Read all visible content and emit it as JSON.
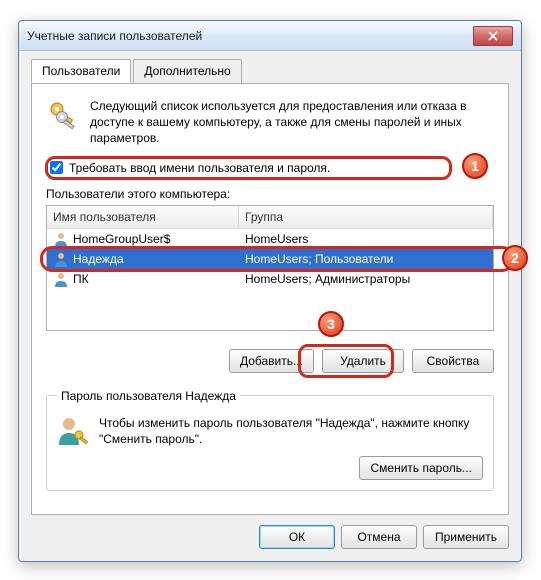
{
  "window": {
    "title": "Учетные записи пользователей"
  },
  "tabs": {
    "users": "Пользователи",
    "advanced": "Дополнительно"
  },
  "intro": "Следующий список используется для предоставления или отказа в доступе к вашему компьютеру, а также для смены паролей и иных параметров.",
  "checkbox": {
    "label": "Требовать ввод имени пользователя и пароля.",
    "checked": true
  },
  "list": {
    "label": "Пользователи этого компьютера:",
    "cols": {
      "user": "Имя пользователя",
      "group": "Группа"
    },
    "rows": [
      {
        "user": "HomeGroupUser$",
        "group": "HomeUsers"
      },
      {
        "user": "Надежда",
        "group": "HomeUsers; Пользователи",
        "selected": true
      },
      {
        "user": "ПК",
        "group": "HomeUsers; Администраторы"
      }
    ]
  },
  "buttons": {
    "add": "Добавить...",
    "remove": "Удалить",
    "properties": "Свойства"
  },
  "password": {
    "legend": "Пароль пользователя Надежда",
    "text": "Чтобы изменить пароль пользователя \"Надежда\", нажмите кнопку \"Сменить пароль\".",
    "change": "Сменить пароль..."
  },
  "dialog": {
    "ok": "ОК",
    "cancel": "Отмена",
    "apply": "Применить"
  },
  "markers": {
    "m1": "1",
    "m2": "2",
    "m3": "3"
  }
}
